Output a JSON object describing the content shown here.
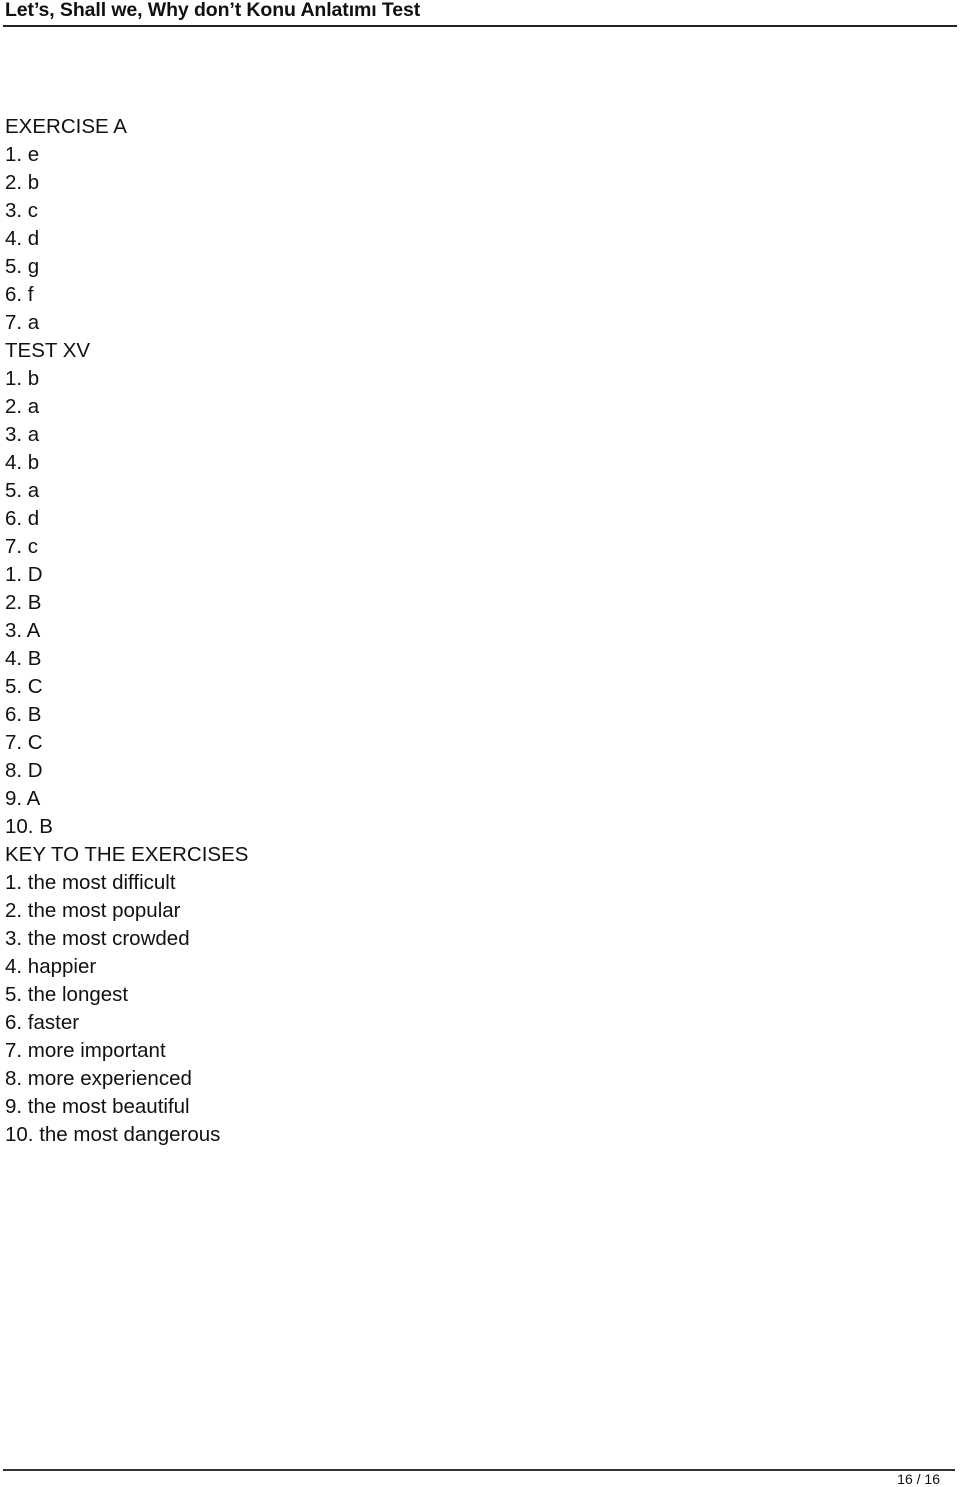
{
  "header": {
    "title": "Let’s, Shall we, Why don’t Konu Anlatımı Test"
  },
  "sections": [
    {
      "heading": "EXERCISE A",
      "answers": [
        "1. e",
        "2. b",
        "3. c",
        "4. d",
        "5. g",
        "6. f",
        "7. a"
      ]
    },
    {
      "heading": "TEST XV",
      "answers": [
        "1. b",
        "2. a",
        "3. a",
        "4. b",
        "5. a",
        "6. d",
        "7. c",
        "1. D",
        "2. B",
        "3. A",
        "4. B",
        "5. C",
        "6. B",
        "7. C",
        "8. D",
        "9. A",
        "10. B"
      ]
    },
    {
      "heading": "KEY TO THE EXERCISES",
      "answers": [
        "1. the most difficult",
        "2. the most popular",
        "3. the most crowded",
        "4. happier",
        "5. the longest",
        "6. faster",
        "7. more important",
        "8. more experienced",
        "9. the most beautiful",
        "10. the most dangerous"
      ]
    }
  ],
  "footer": {
    "page_number": "16 / 16"
  }
}
